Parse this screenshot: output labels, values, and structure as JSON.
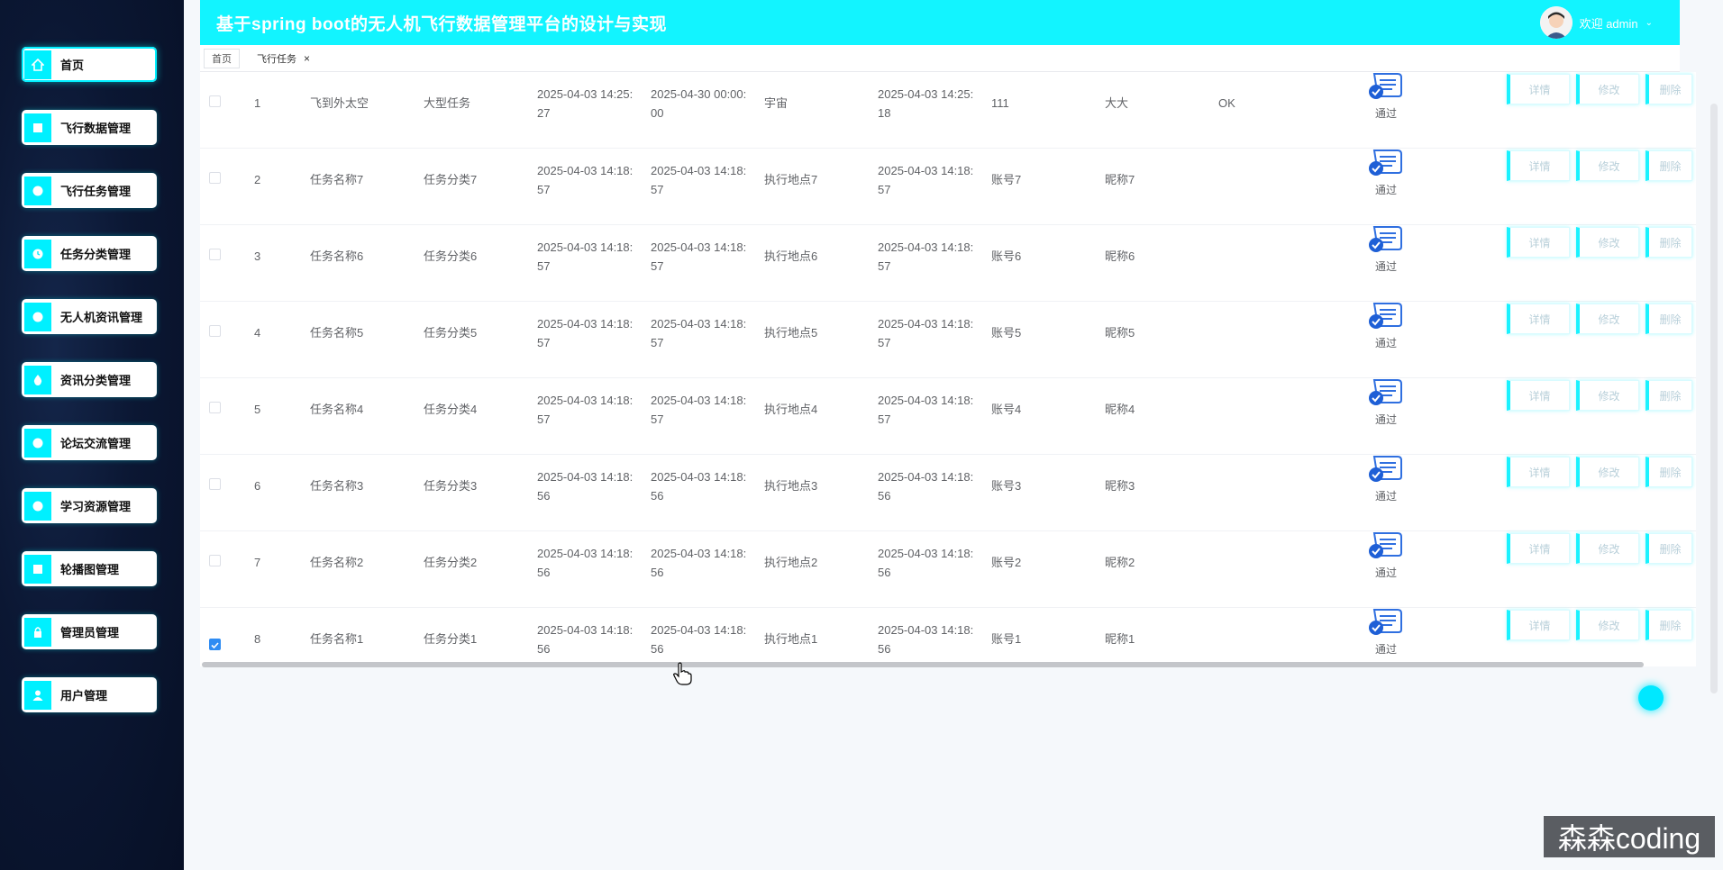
{
  "header": {
    "title": "基于spring boot的无人机飞行数据管理平台的设计与实现",
    "welcome": "欢迎 admin"
  },
  "sidebar": {
    "items": [
      {
        "label": "首页",
        "icon": "home-icon"
      },
      {
        "label": "飞行数据管理",
        "icon": "square-icon"
      },
      {
        "label": "飞行任务管理",
        "icon": "circle-icon"
      },
      {
        "label": "任务分类管理",
        "icon": "clock-icon"
      },
      {
        "label": "无人机资讯管理",
        "icon": "circle-icon"
      },
      {
        "label": "资讯分类管理",
        "icon": "drop-icon"
      },
      {
        "label": "论坛交流管理",
        "icon": "circle-icon"
      },
      {
        "label": "学习资源管理",
        "icon": "circle-icon"
      },
      {
        "label": "轮播图管理",
        "icon": "square-icon"
      },
      {
        "label": "管理员管理",
        "icon": "lock-icon"
      },
      {
        "label": "用户管理",
        "icon": "person-icon"
      }
    ]
  },
  "tabs": [
    {
      "label": "首页"
    },
    {
      "label": "飞行任务",
      "close": "×"
    }
  ],
  "table": {
    "actions": {
      "detail": "详情",
      "edit": "修改",
      "delete": "删除"
    },
    "rows": [
      {
        "idx": "1",
        "name": "飞到外太空",
        "category": "大型任务",
        "start1": "2025-04-03 14:25:",
        "start2": "27",
        "end1": "2025-04-30 00:00:",
        "end2": "00",
        "place": "宇宙",
        "time1": "2025-04-03 14:25:",
        "time2": "18",
        "account": "111",
        "nickname": "大大",
        "reply": "OK",
        "status": "通过",
        "checked": false
      },
      {
        "idx": "2",
        "name": "任务名称7",
        "category": "任务分类7",
        "start1": "2025-04-03 14:18:",
        "start2": "57",
        "end1": "2025-04-03 14:18:",
        "end2": "57",
        "place": "执行地点7",
        "time1": "2025-04-03 14:18:",
        "time2": "57",
        "account": "账号7",
        "nickname": "昵称7",
        "reply": "",
        "status": "通过",
        "checked": false
      },
      {
        "idx": "3",
        "name": "任务名称6",
        "category": "任务分类6",
        "start1": "2025-04-03 14:18:",
        "start2": "57",
        "end1": "2025-04-03 14:18:",
        "end2": "57",
        "place": "执行地点6",
        "time1": "2025-04-03 14:18:",
        "time2": "57",
        "account": "账号6",
        "nickname": "昵称6",
        "reply": "",
        "status": "通过",
        "checked": false
      },
      {
        "idx": "4",
        "name": "任务名称5",
        "category": "任务分类5",
        "start1": "2025-04-03 14:18:",
        "start2": "57",
        "end1": "2025-04-03 14:18:",
        "end2": "57",
        "place": "执行地点5",
        "time1": "2025-04-03 14:18:",
        "time2": "57",
        "account": "账号5",
        "nickname": "昵称5",
        "reply": "",
        "status": "通过",
        "checked": false
      },
      {
        "idx": "5",
        "name": "任务名称4",
        "category": "任务分类4",
        "start1": "2025-04-03 14:18:",
        "start2": "57",
        "end1": "2025-04-03 14:18:",
        "end2": "57",
        "place": "执行地点4",
        "time1": "2025-04-03 14:18:",
        "time2": "57",
        "account": "账号4",
        "nickname": "昵称4",
        "reply": "",
        "status": "通过",
        "checked": false
      },
      {
        "idx": "6",
        "name": "任务名称3",
        "category": "任务分类3",
        "start1": "2025-04-03 14:18:",
        "start2": "56",
        "end1": "2025-04-03 14:18:",
        "end2": "56",
        "place": "执行地点3",
        "time1": "2025-04-03 14:18:",
        "time2": "56",
        "account": "账号3",
        "nickname": "昵称3",
        "reply": "",
        "status": "通过",
        "checked": false
      },
      {
        "idx": "7",
        "name": "任务名称2",
        "category": "任务分类2",
        "start1": "2025-04-03 14:18:",
        "start2": "56",
        "end1": "2025-04-03 14:18:",
        "end2": "56",
        "place": "执行地点2",
        "time1": "2025-04-03 14:18:",
        "time2": "56",
        "account": "账号2",
        "nickname": "昵称2",
        "reply": "",
        "status": "通过",
        "checked": false
      },
      {
        "idx": "8",
        "name": "任务名称1",
        "category": "任务分类1",
        "start1": "2025-04-03 14:18:",
        "start2": "56",
        "end1": "2025-04-03 14:18:",
        "end2": "56",
        "place": "执行地点1",
        "time1": "2025-04-03 14:18:",
        "time2": "56",
        "account": "账号1",
        "nickname": "昵称1",
        "reply": "",
        "status": "通过",
        "checked": true
      }
    ]
  },
  "watermark": "森森coding",
  "colors": {
    "accent": "#12f4ff",
    "sidebar_bg": "#0b1733",
    "checkbox": "#2f8cf3"
  }
}
